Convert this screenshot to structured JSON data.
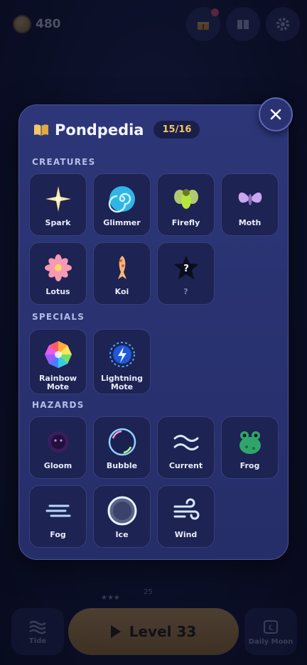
{
  "topbar": {
    "coins": "480"
  },
  "modal": {
    "title": "Pondpedia",
    "count": "15/16"
  },
  "sections": {
    "creatures": {
      "label": "CREATURES",
      "items": [
        {
          "label": "Spark",
          "icon": "spark-icon"
        },
        {
          "label": "Glimmer",
          "icon": "glimmer-icon"
        },
        {
          "label": "Firefly",
          "icon": "firefly-icon"
        },
        {
          "label": "Moth",
          "icon": "moth-icon"
        },
        {
          "label": "Lotus",
          "icon": "lotus-icon"
        },
        {
          "label": "Koi",
          "icon": "koi-icon"
        },
        {
          "label": "?",
          "icon": "locked-creature-icon"
        }
      ]
    },
    "specials": {
      "label": "SPECIALS",
      "items": [
        {
          "label_line1": "Rainbow",
          "label_line2": "Mote",
          "icon": "rainbow-mote-icon"
        },
        {
          "label_line1": "Lightning",
          "label_line2": "Mote",
          "icon": "lightning-mote-icon"
        }
      ]
    },
    "hazards": {
      "label": "HAZARDS",
      "items": [
        {
          "label": "Gloom",
          "icon": "gloom-icon"
        },
        {
          "label": "Bubble",
          "icon": "bubble-icon"
        },
        {
          "label": "Current",
          "icon": "current-icon"
        },
        {
          "label": "Frog",
          "icon": "frog-icon"
        },
        {
          "label": "Fog",
          "icon": "fog-icon"
        },
        {
          "label": "Ice",
          "icon": "ice-icon"
        },
        {
          "label": "Wind",
          "icon": "wind-icon"
        }
      ]
    }
  },
  "bottombar": {
    "tide_label": "Tide",
    "play_label": "Level 33",
    "daily_label": "Daily Moon",
    "path_node": "25"
  },
  "colors": {
    "accent": "#f3c767",
    "panel": "#2d3678",
    "tile": "#1d2352"
  }
}
